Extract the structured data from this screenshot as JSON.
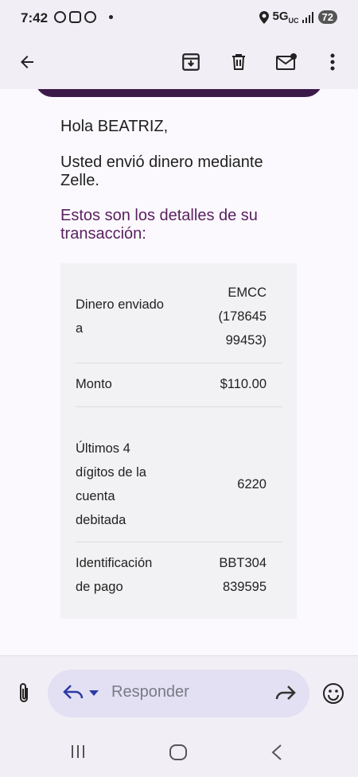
{
  "status_bar": {
    "time": "7:42",
    "network": "5G",
    "network_sub": "UC",
    "battery": "72"
  },
  "icons": {
    "back": "arrow-back-icon",
    "archive": "archive-icon",
    "delete": "trash-icon",
    "unread": "mark-unread-icon",
    "more": "more-vert-icon"
  },
  "email": {
    "greeting": "Hola BEATRIZ,",
    "intro": "Usted envió dinero mediante Zelle.",
    "details_title": "Estos son los detalles de su transacción:",
    "rows": [
      {
        "key": [
          "Dinero enviado",
          "a"
        ],
        "value": [
          "EMCC",
          "(178645",
          "99453)"
        ]
      },
      {
        "key": [
          "Monto"
        ],
        "value": [
          "$110.00"
        ]
      },
      {
        "key": [
          "Últimos 4",
          "dígitos de la",
          "cuenta",
          "debitada"
        ],
        "value": [
          "6220"
        ]
      },
      {
        "key": [
          "Identificación",
          "de pago"
        ],
        "value": [
          "BBT304",
          "839595"
        ]
      }
    ]
  },
  "compose": {
    "reply_placeholder": "Responder"
  },
  "colors": {
    "background": "#f1eef5",
    "accent_purple": "#5a1f5f",
    "reply_pill": "#e2e0f2"
  }
}
